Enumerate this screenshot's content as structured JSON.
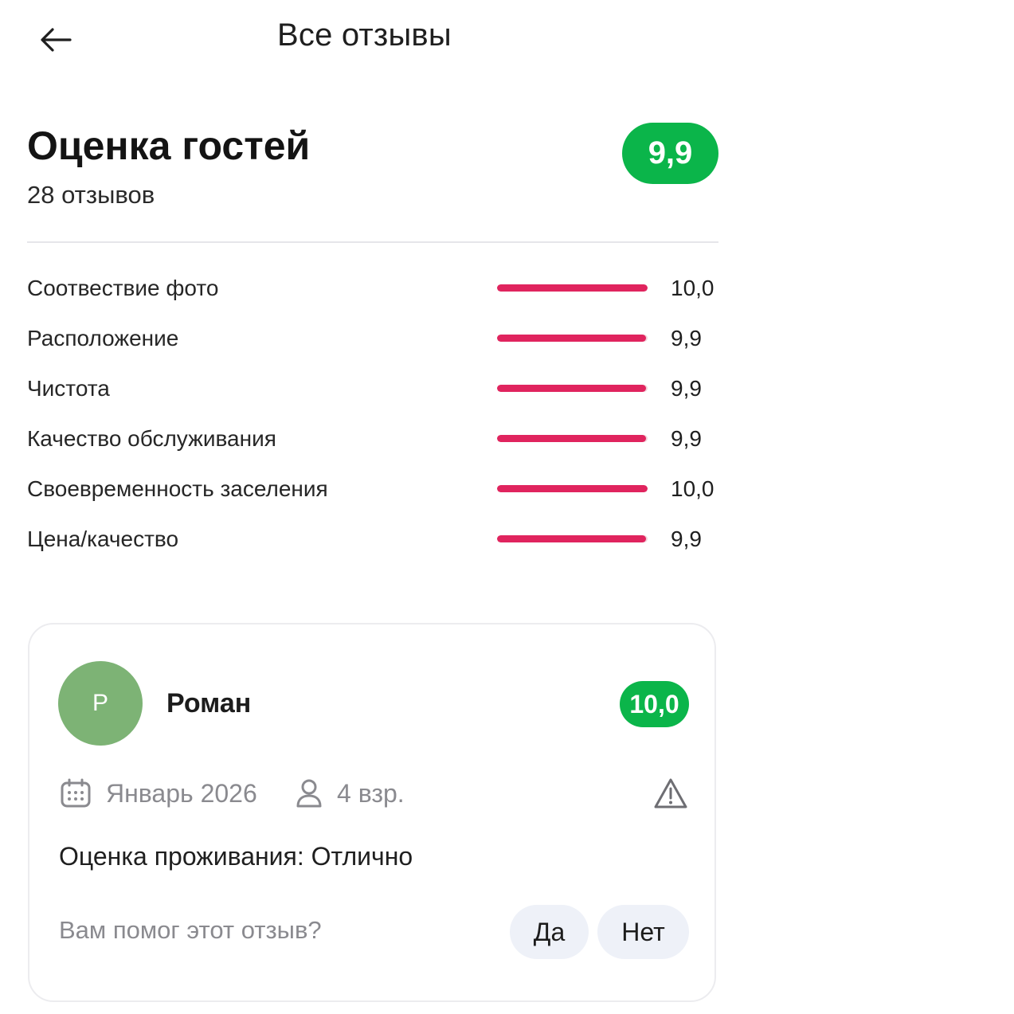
{
  "header": {
    "title": "Все отзывы",
    "back_icon": "arrow-left-icon"
  },
  "summary": {
    "title": "Оценка гостей",
    "count": "28 отзывов",
    "score": "9,9",
    "score_color": "#0bb54a"
  },
  "ratings": {
    "bar_color": "#e0245e",
    "items": [
      {
        "label": "Соотвествие фото",
        "value": "10,0",
        "fill": 1.0
      },
      {
        "label": "Расположение",
        "value": "9,9",
        "fill": 0.99
      },
      {
        "label": "Чистота",
        "value": "9,9",
        "fill": 0.99
      },
      {
        "label": "Качество обслуживания",
        "value": "9,9",
        "fill": 0.99
      },
      {
        "label": "Своевременность заселения",
        "value": "10,0",
        "fill": 1.0
      },
      {
        "label": "Цена/качество",
        "value": "9,9",
        "fill": 0.99
      }
    ]
  },
  "review": {
    "avatar_letter": "Р",
    "avatar_color": "#7db375",
    "name": "Роман",
    "score": "10,0",
    "score_color": "#0bb54a",
    "date": "Январь 2026",
    "date_icon": "calendar-icon",
    "guests": "4 взр.",
    "guests_icon": "person-icon",
    "report_icon": "warning-icon",
    "text": "Оценка проживания: Отлично",
    "helpful_question": "Вам помог этот отзыв?",
    "yes_label": "Да",
    "no_label": "Нет"
  }
}
